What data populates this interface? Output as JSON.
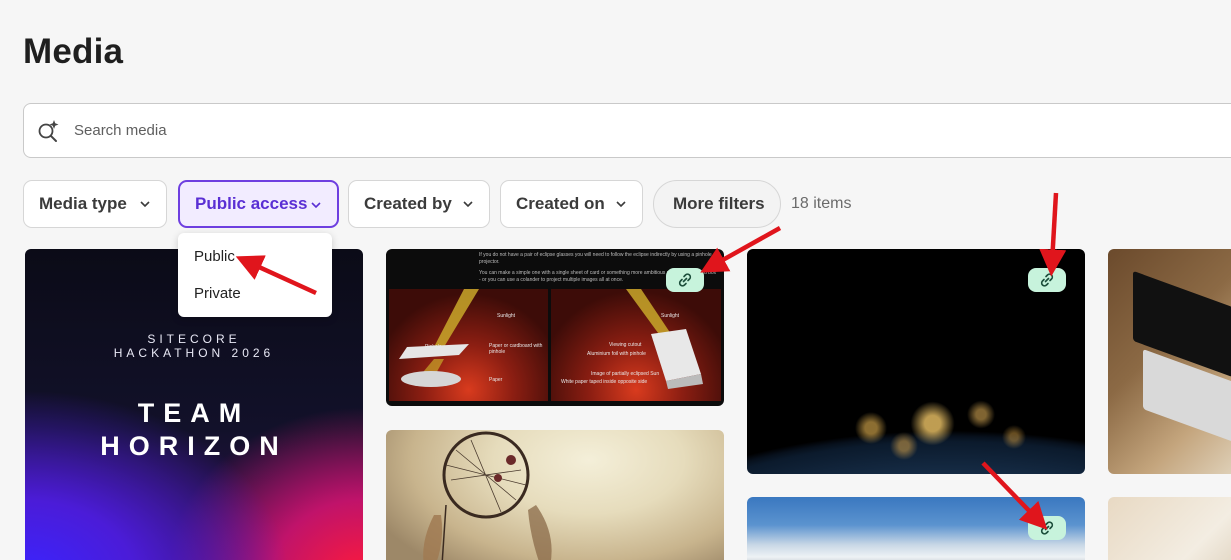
{
  "page": {
    "title": "Media"
  },
  "search": {
    "placeholder": "Search media",
    "value": ""
  },
  "filters": [
    {
      "label": "Media type"
    },
    {
      "label": "Public access",
      "active": true
    },
    {
      "label": "Created by"
    },
    {
      "label": "Created on"
    },
    {
      "label": "More filters"
    }
  ],
  "items_count": "18 items",
  "public_access_dropdown": {
    "options": [
      "Public",
      "Private"
    ]
  },
  "cards": {
    "team_horizon": {
      "line1": "SITECORE",
      "line2": "HACKATHON 2026",
      "big1": "TEAM",
      "big2": "HORIZON"
    },
    "eclipse": {
      "text1": "If you do not have a pair of eclipse glasses you will need to follow the eclipse indirectly by using a pinhole projector.",
      "text2": "You can make a simple one with a single sheet of card or something more ambitious using a cardboard box - or you can use a colander to project multiple images all at once.",
      "left_labels": [
        "Sunlight",
        "Pinhole",
        "Paper or cardboard with pinhole",
        "Paper"
      ],
      "right_labels": [
        "Sunlight",
        "Viewing cutout",
        "Aluminium foil with pinhole",
        "Image of partially eclipsed Sun",
        "White paper taped inside opposite side"
      ]
    }
  },
  "colors": {
    "accent": "#6e3fe0",
    "link_badge": "#c7f3dc",
    "annotation_arrow": "#e0151c"
  },
  "icons": {
    "search": "search-sparkle-icon",
    "chevron": "chevron-down-icon",
    "link": "link-icon"
  }
}
